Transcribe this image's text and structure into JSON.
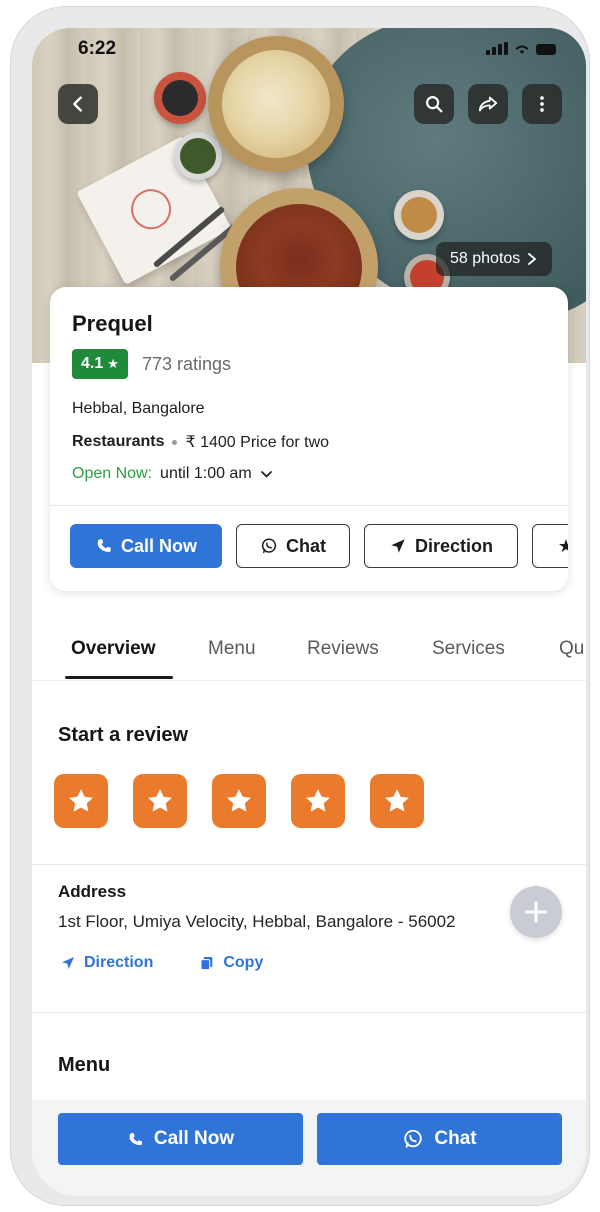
{
  "status_bar": {
    "time": "6:22"
  },
  "hero": {
    "photos_label": "58 photos"
  },
  "restaurant": {
    "name": "Prequel",
    "rating": "4.1",
    "ratings_count": "773 ratings",
    "location": "Hebbal, Bangalore",
    "category": "Restaurants",
    "price": "₹ 1400 Price for two",
    "open_status": "Open Now:",
    "hours": "until 1:00 am"
  },
  "actions": {
    "call": "Call Now",
    "chat": "Chat",
    "direction": "Direction"
  },
  "tabs": [
    "Overview",
    "Menu",
    "Reviews",
    "Services",
    "Qu"
  ],
  "review": {
    "title": "Start a review",
    "star_count": 5
  },
  "address": {
    "label": "Address",
    "text": "1st Floor, Umiya Velocity, Hebbal, Bangalore - 56002",
    "direction_link": "Direction",
    "copy_link": "Copy"
  },
  "menu_section": {
    "title": "Menu"
  },
  "bottom_bar": {
    "call": "Call Now",
    "chat": "Chat"
  },
  "colors": {
    "primary_blue": "#2f74d6",
    "rating_green": "#1f8a3a",
    "open_green": "#2f9e44",
    "star_orange": "#ea7b2c"
  }
}
